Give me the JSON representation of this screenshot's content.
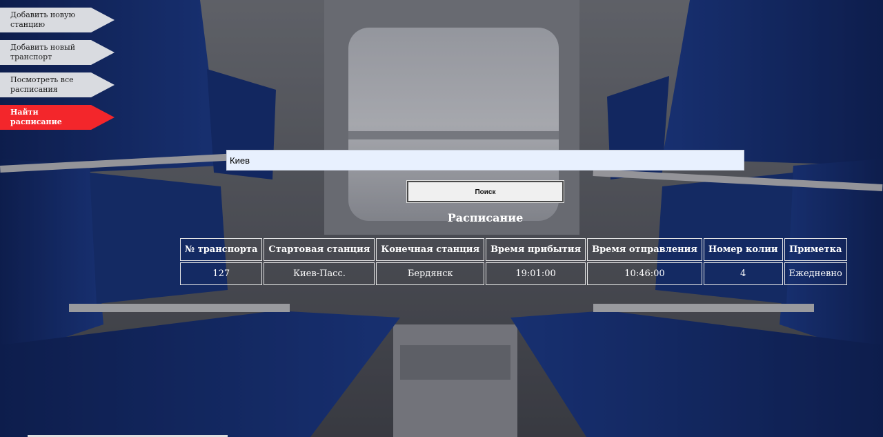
{
  "menu": {
    "items": [
      {
        "label": "Добавить новую станцию",
        "active": false
      },
      {
        "label": "Добавить новый транспорт",
        "active": false
      },
      {
        "label": "Посмотреть все расписания",
        "active": false
      },
      {
        "label": "Найти расписание",
        "active": true
      }
    ]
  },
  "search": {
    "value": "Киев",
    "button_label": "Поиск"
  },
  "schedule": {
    "title": "Расписание",
    "columns": [
      "№ транспорта",
      "Стартовая станция",
      "Конечная станция",
      "Время прибытия",
      "Время отправления",
      "Номер колии",
      "Приметка"
    ],
    "rows": [
      [
        "127",
        "Киев-Пасс.",
        "Бердянск",
        "19:01:00",
        "10:46:00",
        "4",
        "Ежедневно"
      ]
    ]
  },
  "colors": {
    "menu_default": "#d9dbe0",
    "menu_active": "#f3262b",
    "input_bg": "#e8f0fe",
    "seat_blue": "#1b3a8c"
  }
}
